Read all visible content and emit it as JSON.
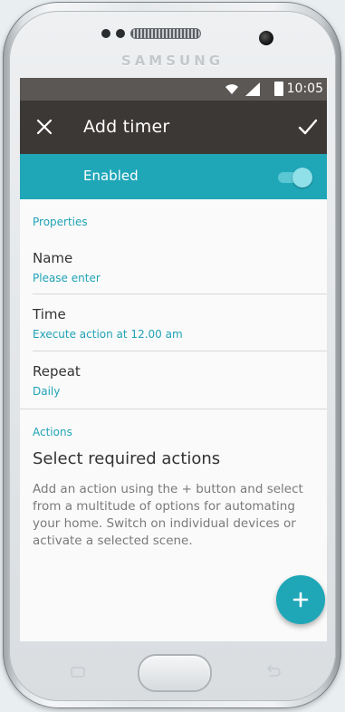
{
  "device": {
    "brand": "SAMSUNG"
  },
  "status_bar": {
    "time": "10:05"
  },
  "app_bar": {
    "title": "Add timer"
  },
  "enabled_row": {
    "label": "Enabled",
    "toggle_on": true
  },
  "properties": {
    "heading": "Properties",
    "items": [
      {
        "name": "Name",
        "value": "Please enter"
      },
      {
        "name": "Time",
        "value": "Execute action at 12.00 am"
      },
      {
        "name": "Repeat",
        "value": "Daily"
      }
    ]
  },
  "actions": {
    "heading": "Actions",
    "title": "Select required actions",
    "description": "Add an action using the + button and select from a multitude of options for automating your home. Switch on individual devices or activate a selected scene."
  },
  "fab": {
    "icon": "plus-icon",
    "symbol": "+"
  },
  "colors": {
    "accent": "#1fa7b8",
    "app_bar": "#3c3836",
    "status_bar": "#5b5754"
  }
}
